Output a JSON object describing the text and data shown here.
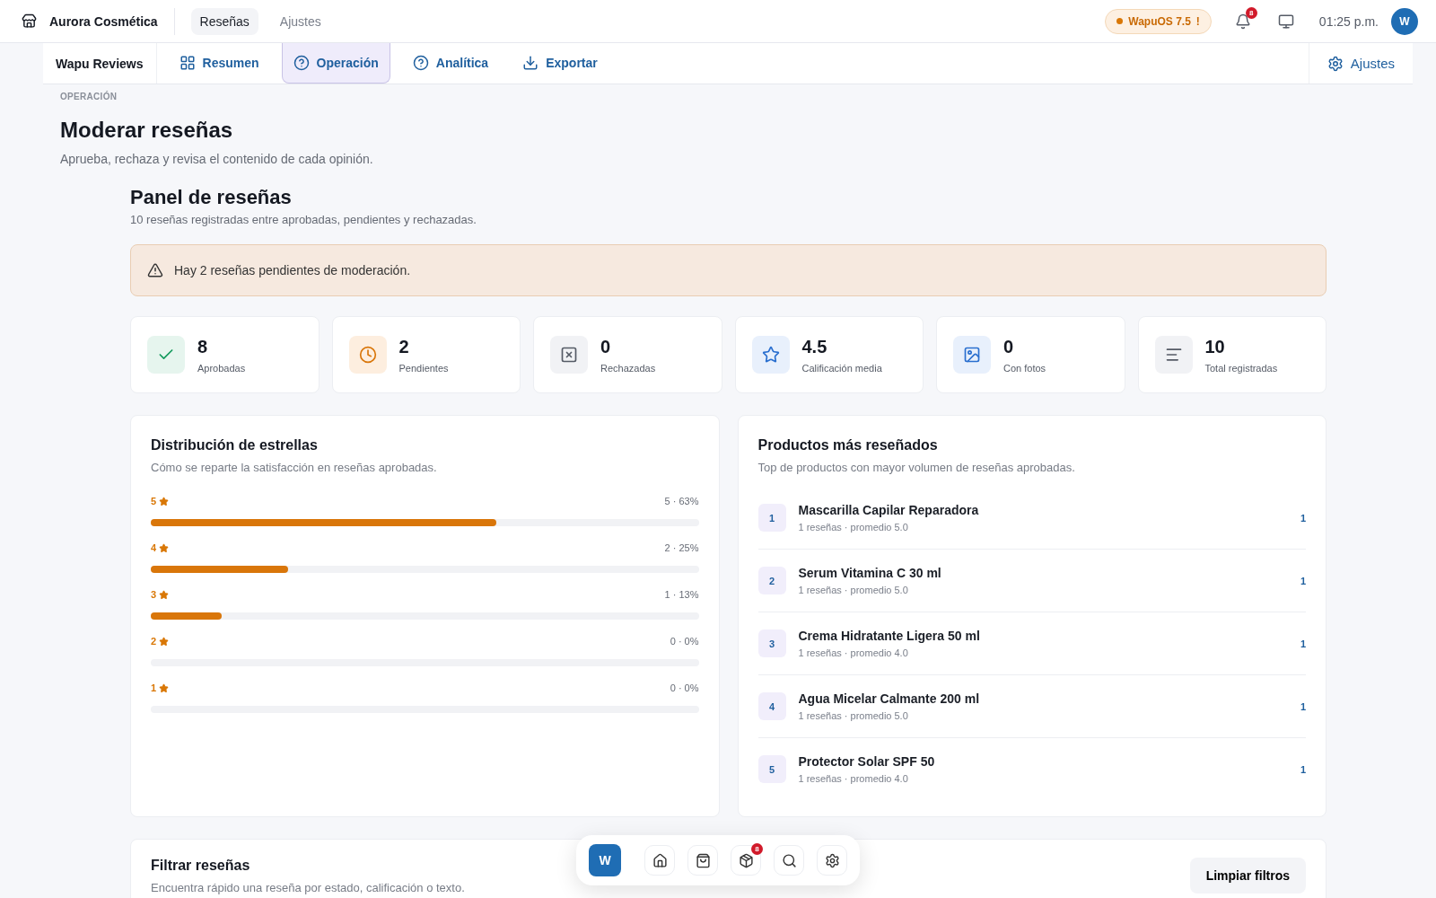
{
  "topbar": {
    "brand": "Aurora Cosmética",
    "nav": [
      {
        "label": "Reseñas",
        "selected": true
      },
      {
        "label": "Ajustes",
        "selected": false
      }
    ],
    "version_badge": {
      "label": "WapuOS 7.5",
      "alert": "!"
    },
    "notifications": {
      "count": "8"
    },
    "time": "01:25 p.m.",
    "avatar": "W"
  },
  "subnav": {
    "app_name": "Wapu Reviews",
    "tabs": [
      {
        "label": "Resumen",
        "selected": false
      },
      {
        "label": "Operación",
        "selected": true
      },
      {
        "label": "Analítica",
        "selected": false
      },
      {
        "label": "Exportar",
        "selected": false
      }
    ],
    "settings_label": "Ajustes"
  },
  "page": {
    "eyebrow": "OPERACIÓN",
    "title": "Moderar reseñas",
    "subtitle": "Aprueba, rechaza y revisa el contenido de cada opinión."
  },
  "panel": {
    "title": "Panel de reseñas",
    "subtitle": "10 reseñas registradas entre aprobadas, pendientes y rechazadas.",
    "alert": "Hay 2 reseñas pendientes de moderación.",
    "stats": [
      {
        "kind": "approved",
        "value": "8",
        "label": "Aprobadas"
      },
      {
        "kind": "pending",
        "value": "2",
        "label": "Pendientes"
      },
      {
        "kind": "rejected",
        "value": "0",
        "label": "Rechazadas"
      },
      {
        "kind": "rating",
        "value": "4.5",
        "label": "Calificación media"
      },
      {
        "kind": "photos",
        "value": "0",
        "label": "Con fotos"
      },
      {
        "kind": "total",
        "value": "10",
        "label": "Total registradas"
      }
    ]
  },
  "star_distribution": {
    "title": "Distribución de estrellas",
    "subtitle": "Cómo se reparte la satisfacción en reseñas aprobadas.",
    "rows": [
      {
        "stars": "5",
        "reading": "5 · 63%",
        "level": 0.63
      },
      {
        "stars": "4",
        "reading": "2 · 25%",
        "level": 0.25
      },
      {
        "stars": "3",
        "reading": "1 · 13%",
        "level": 0.13
      },
      {
        "stars": "2",
        "reading": "0 · 0%"
      },
      {
        "stars": "1",
        "reading": "0 · 0%"
      }
    ]
  },
  "top_products": {
    "title": "Productos más reseñados",
    "subtitle": "Top de productos con mayor volumen de reseñas aprobadas.",
    "items": [
      {
        "rank": "1",
        "name": "Mascarilla Capilar Reparadora",
        "meta": "1 reseñas · promedio 5.0",
        "count": "1"
      },
      {
        "rank": "2",
        "name": "Serum Vitamina C 30 ml",
        "meta": "1 reseñas · promedio 5.0",
        "count": "1"
      },
      {
        "rank": "3",
        "name": "Crema Hidratante Ligera 50 ml",
        "meta": "1 reseñas · promedio 4.0",
        "count": "1"
      },
      {
        "rank": "4",
        "name": "Agua Micelar Calmante 200 ml",
        "meta": "1 reseñas · promedio 5.0",
        "count": "1"
      },
      {
        "rank": "5",
        "name": "Protector Solar SPF 50",
        "meta": "1 reseñas · promedio 4.0",
        "count": "1"
      }
    ]
  },
  "filters": {
    "title": "Filtrar reseñas",
    "subtitle": "Encuentra rápido una reseña por estado, calificación o texto.",
    "clear_button": "Limpiar filtros"
  },
  "dock": {
    "items": [
      {
        "kind": "avatar",
        "label": "W"
      },
      {
        "kind": "home"
      },
      {
        "kind": "bag"
      },
      {
        "kind": "package",
        "badge": "8"
      },
      {
        "kind": "search"
      },
      {
        "kind": "settings"
      }
    ]
  }
}
